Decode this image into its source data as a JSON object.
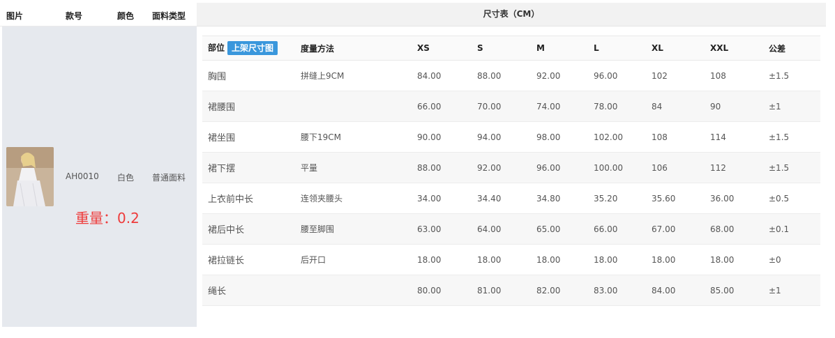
{
  "left_table": {
    "headers": {
      "image": "图片",
      "code": "款号",
      "color": "颜色",
      "fabric": "面料类型"
    },
    "row": {
      "code": "AH0010",
      "color": "白色",
      "fabric": "普通面料"
    },
    "weight_text": "重量：0.2"
  },
  "size_chart": {
    "title": "尺寸表（CM）",
    "upload_button": "上架尺寸图",
    "headers": [
      "部位",
      "度量方法",
      "XS",
      "S",
      "M",
      "L",
      "XL",
      "XXL",
      "公差"
    ],
    "rows": [
      [
        "胸围",
        "拼缝上9CM",
        "84.00",
        "88.00",
        "92.00",
        "96.00",
        "102",
        "108",
        "±1.5"
      ],
      [
        "裙腰围",
        "",
        "66.00",
        "70.00",
        "74.00",
        "78.00",
        "84",
        "90",
        "±1"
      ],
      [
        "裙坐围",
        "腰下19CM",
        "90.00",
        "94.00",
        "98.00",
        "102.00",
        "108",
        "114",
        "±1.5"
      ],
      [
        "裙下摆",
        "平量",
        "88.00",
        "92.00",
        "96.00",
        "100.00",
        "106",
        "112",
        "±1.5"
      ],
      [
        "上衣前中长",
        "连领夹腰头",
        "34.00",
        "34.40",
        "34.80",
        "35.20",
        "35.60",
        "36.00",
        "±0.5"
      ],
      [
        "裙后中长",
        "腰至脚围",
        "63.00",
        "64.00",
        "65.00",
        "66.00",
        "67.00",
        "68.00",
        "±0.1"
      ],
      [
        "裙拉链长",
        "后开口",
        "18.00",
        "18.00",
        "18.00",
        "18.00",
        "18.00",
        "18.00",
        "±0"
      ],
      [
        "绳长",
        "",
        "80.00",
        "81.00",
        "82.00",
        "83.00",
        "84.00",
        "85.00",
        "±1"
      ]
    ]
  },
  "colors": {
    "accent": "#3a97dc",
    "weight": "#ee3b3b",
    "left_bg": "#e6e9ee"
  }
}
